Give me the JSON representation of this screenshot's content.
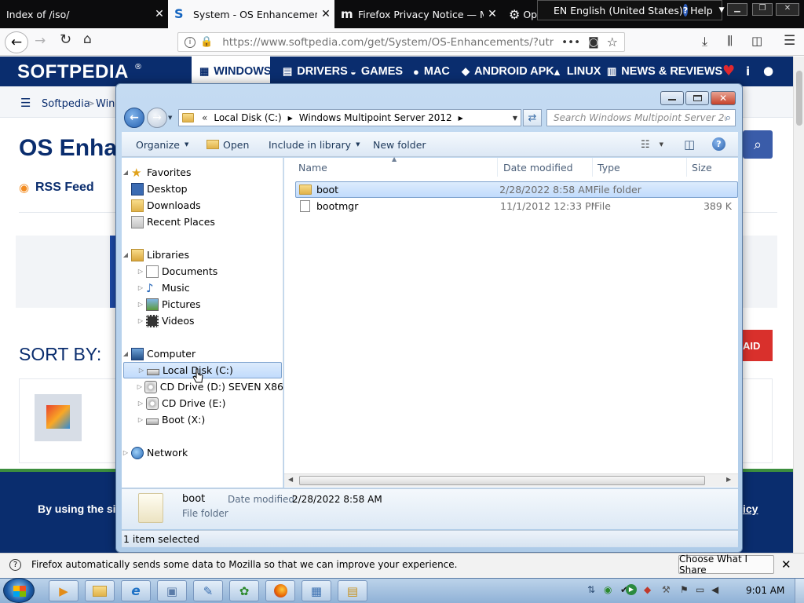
{
  "browser": {
    "tabs": [
      {
        "title": "Index of /iso/",
        "active": false
      },
      {
        "title": "System - OS Enhancements Downl",
        "active": true
      },
      {
        "title": "Firefox Privacy Notice — Mozil",
        "active": false
      },
      {
        "title": "Op",
        "active": false
      }
    ],
    "url": "https://www.softpedia.com/get/System/OS-Enhancements/?utm_",
    "lang_bar": {
      "lang": "EN English (United States)",
      "help": "Help"
    }
  },
  "site": {
    "logo": "SOFTPEDIA",
    "nav": [
      "WINDOWS",
      "DRIVERS",
      "GAMES",
      "MAC",
      "ANDROID APK",
      "LINUX",
      "NEWS & REVIEWS"
    ],
    "breadcrumb": [
      "Softpedia",
      "Windo"
    ],
    "page_title": "OS Enhan",
    "rss": "RSS Feed",
    "sort_by": "SORT BY:",
    "paid_button": "AID",
    "cookie_text": "By using the site y",
    "cookie_link": "icy",
    "accent": "#0a2d6e"
  },
  "explorer": {
    "address": [
      "Local Disk (C:)",
      "Windows Multipoint Server 2012"
    ],
    "address_prefix": "«",
    "search_placeholder": "Search Windows Multipoint Server 2012",
    "commands": {
      "organize": "Organize",
      "open": "Open",
      "include": "Include in library",
      "new_folder": "New folder"
    },
    "nav": {
      "favorites": {
        "label": "Favorites",
        "items": [
          "Desktop",
          "Downloads",
          "Recent Places"
        ]
      },
      "libraries": {
        "label": "Libraries",
        "items": [
          "Documents",
          "Music",
          "Pictures",
          "Videos"
        ]
      },
      "computer": {
        "label": "Computer",
        "items": [
          "Local Disk (C:)",
          "CD Drive (D:) SEVEN X86",
          "CD Drive (E:)",
          "Boot (X:)"
        ]
      },
      "network": "Network"
    },
    "columns": [
      "Name",
      "Date modified",
      "Type",
      "Size"
    ],
    "files": [
      {
        "name": "boot",
        "date": "2/28/2022 8:58 AM",
        "type": "File folder",
        "size": ""
      },
      {
        "name": "bootmgr",
        "date": "11/1/2012 12:33 PM",
        "type": "File",
        "size": "389 K"
      }
    ],
    "details": {
      "name": "boot",
      "date_label": "Date modified:",
      "date": "2/28/2022 8:58 AM",
      "type": "File folder"
    },
    "status": "1 item selected"
  },
  "notification": {
    "text": "Firefox automatically sends some data to Mozilla so that we can improve your experience.",
    "button": "Choose What I Share"
  },
  "taskbar": {
    "clock": "9:01 AM"
  }
}
